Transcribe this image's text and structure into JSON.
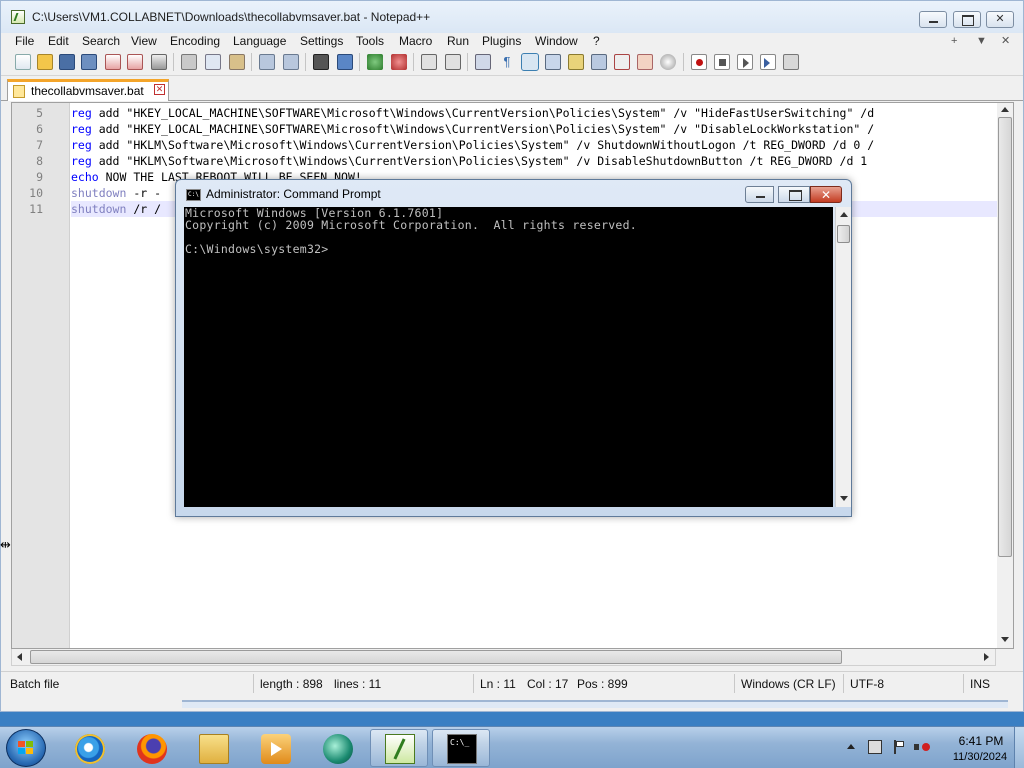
{
  "npp": {
    "title": "C:\\Users\\VM1.COLLABNET\\Downloads\\thecollabvmsaver.bat - Notepad++",
    "menu": [
      "File",
      "Edit",
      "Search",
      "View",
      "Encoding",
      "Language",
      "Settings",
      "Tools",
      "Macro",
      "Run",
      "Plugins",
      "Window",
      "?"
    ],
    "menu_right": {
      "plus": "+",
      "down": "▼",
      "close": "✕"
    },
    "tab": {
      "label": "thecollabvmsaver.bat"
    },
    "lines": [
      {
        "num": "5",
        "kw": "reg",
        "rest": " add \"HKEY_LOCAL_MACHINE\\SOFTWARE\\Microsoft\\Windows\\CurrentVersion\\Policies\\System\" /v \"HideFastUserSwitching\" /d"
      },
      {
        "num": "6",
        "kw": "reg",
        "rest": " add \"HKEY_LOCAL_MACHINE\\SOFTWARE\\Microsoft\\Windows\\CurrentVersion\\Policies\\System\" /v \"DisableLockWorkstation\" /"
      },
      {
        "num": "7",
        "kw": "reg",
        "rest": " add \"HKLM\\Software\\Microsoft\\Windows\\CurrentVersion\\Policies\\System\" /v ShutdownWithoutLogon /t REG_DWORD /d 0 /"
      },
      {
        "num": "8",
        "kw": "reg",
        "rest": " add \"HKLM\\Software\\Microsoft\\Windows\\CurrentVersion\\Policies\\System\" /v DisableShutdownButton /t REG_DWORD /d 1"
      },
      {
        "num": "9",
        "kw": "echo",
        "rest": " NOW THE LAST REBOOT WILL BE SEEN NOW!"
      },
      {
        "num": "10",
        "kw": "shutdown",
        "rest": " -r -"
      },
      {
        "num": "11",
        "kw": "shutdown",
        "rest": " /r /"
      }
    ],
    "status": {
      "filetype": "Batch file",
      "length": "length : 898",
      "lines": "lines : 11",
      "ln": "Ln : 11",
      "col": "Col : 17",
      "pos": "Pos : 899",
      "eol": "Windows (CR LF)",
      "encoding": "UTF-8",
      "mode": "INS"
    }
  },
  "cmd": {
    "title": "Administrator: Command Prompt",
    "icon_text": "C:\\",
    "console": "Microsoft Windows [Version 6.1.7601]\nCopyright (c) 2009 Microsoft Corporation.  All rights reserved.\n\nC:\\Windows\\system32>"
  },
  "taskbar": {
    "time": "6:41 PM",
    "date": "11/30/2024",
    "apps": [
      {
        "name": "internet-explorer",
        "running": false
      },
      {
        "name": "firefox",
        "running": false
      },
      {
        "name": "windows-explorer",
        "running": false
      },
      {
        "name": "media-player",
        "running": false
      },
      {
        "name": "remote-app",
        "running": false
      },
      {
        "name": "notepad-plus-plus",
        "running": true
      },
      {
        "name": "command-prompt",
        "running": true
      }
    ]
  },
  "colors": {
    "keyword": "#0000ff",
    "keyword_light": "#8080c0",
    "tab_accent": "#f4a52a",
    "console_text": "#c0c0c0"
  }
}
